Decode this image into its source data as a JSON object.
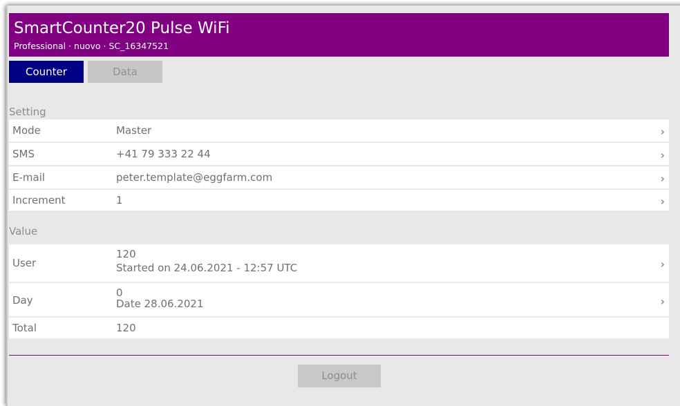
{
  "header": {
    "title": "SmartCounter20 Pulse WiFi",
    "subtitle": "Professional · nuovo · SC_16347521"
  },
  "tabs": [
    {
      "label": "Counter",
      "active": true
    },
    {
      "label": "Data",
      "active": false
    }
  ],
  "setting": {
    "heading": "Setting",
    "rows": [
      {
        "label": "Mode",
        "value": "Master"
      },
      {
        "label": "SMS",
        "value": "+41 79 333 22 44"
      },
      {
        "label": "E-mail",
        "value": "peter.template@eggfarm.com"
      },
      {
        "label": "Increment",
        "value": "1"
      }
    ]
  },
  "value": {
    "heading": "Value",
    "rows": [
      {
        "label": "User",
        "value": "120",
        "sub": "Started on 24.06.2021 - 12:57 UTC"
      },
      {
        "label": "Day",
        "value": "0",
        "sub": "Date 28.06.2021"
      },
      {
        "label": "Total",
        "value": "120"
      }
    ]
  },
  "chevron": "›",
  "logout_label": "Logout",
  "colors": {
    "header": "#820082",
    "active_tab": "#000082",
    "inactive_tab": "#c6c6c6",
    "background": "#e8e8e8"
  }
}
